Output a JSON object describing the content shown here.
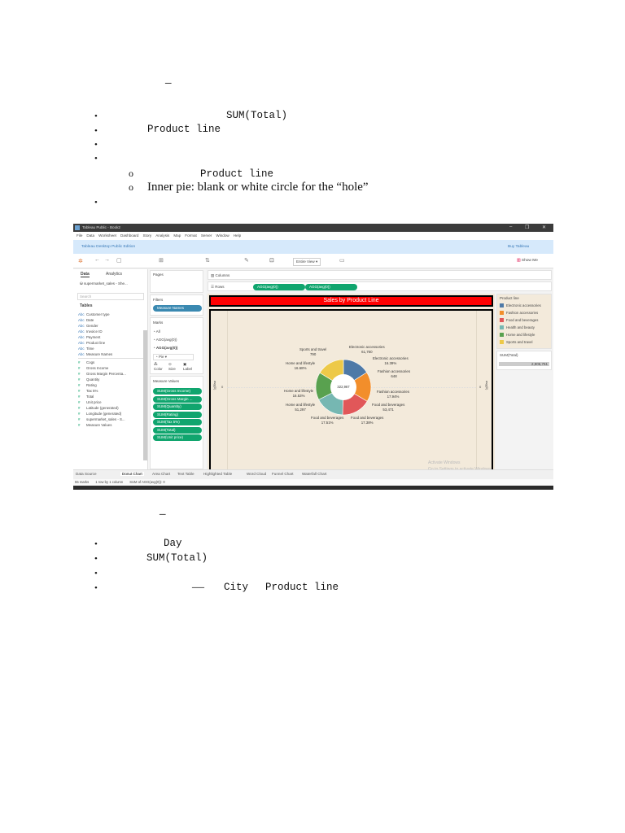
{
  "top_section": {
    "dash": "–",
    "bullets": [
      {
        "marker": "•",
        "code": "SUM(Total)"
      },
      {
        "marker": "•",
        "code": "Product line"
      },
      {
        "marker": "•"
      },
      {
        "marker": "•"
      }
    ],
    "sub_bullets": [
      {
        "marker": "o",
        "code": "Product line"
      },
      {
        "marker": "o",
        "text": "Inner pie: blank or white circle for the “hole”"
      }
    ],
    "last_bullet": "•"
  },
  "tableau": {
    "window_title": "Tableau Public - Book2",
    "window_controls": [
      "–",
      "❐",
      "✕"
    ],
    "menu": [
      "File",
      "Data",
      "Worksheet",
      "Dashboard",
      "Story",
      "Analysis",
      "Map",
      "Format",
      "Server",
      "Window",
      "Help"
    ],
    "edition": "Tableau Desktop Public Edition",
    "buy": "Buy Tableau",
    "fit_select": "Entire View",
    "show_me": "Show Me",
    "data_tabs": [
      "Data",
      "Analytics"
    ],
    "datasource": "supermarket_sales - She...",
    "search_placeholder": "Search",
    "tables_heading": "Tables",
    "dimensions": [
      "Customer type",
      "Date",
      "Gender",
      "Invoice ID",
      "Payment",
      "Product line",
      "Time",
      "Measure Names"
    ],
    "measures": [
      "Cogs",
      "Gross Income",
      "Gross Margin Percenta...",
      "Quantity",
      "Rating",
      "Tax 5%",
      "Total",
      "Unit price",
      "Latitude (generated)",
      "Longitude (generated)",
      "supermarket_sales - S...",
      "Measure Values"
    ],
    "pages": "Pages",
    "filters": "Filters",
    "filter_pill": "Measure Names",
    "marks": "Marks",
    "marks_items": [
      "All",
      "AGG(avg(0))",
      "AGG(avg(0))"
    ],
    "mark_type": "Pie",
    "mark_buttons": [
      "Color",
      "Size",
      "Label"
    ],
    "measure_values": "Measure Values",
    "measure_pills": [
      "SUM(Gross Income)",
      "SUM(Gross Margin ...",
      "SUM(Quantity)",
      "SUM(Rating)",
      "SUM(Tax 5%)",
      "SUM(Total)",
      "SUM(Unit price)"
    ],
    "columns": "Columns",
    "rows": "Rows",
    "row_pills": [
      "AGG(avg(0))",
      "AGG(avg(0))"
    ],
    "chart_title": "Sales by Product Line",
    "axis_label": "avg(0)",
    "axis_zero": "0",
    "center_total": "322,967",
    "legend_title": "Product line",
    "legend": [
      {
        "name": "Electronic accessories",
        "color": "#4e79a7"
      },
      {
        "name": "Fashion accessories",
        "color": "#f28e2b"
      },
      {
        "name": "Food and beverages",
        "color": "#e15759"
      },
      {
        "name": "Health and beauty",
        "color": "#76b7b2"
      },
      {
        "name": "Home and lifestyle",
        "color": "#59a14f"
      },
      {
        "name": "Sports and travel",
        "color": "#edc948"
      }
    ],
    "sum_total_title": "SUM(Total)",
    "sum_total_value": "2,906,761",
    "watermark": [
      "Activate Windows",
      "Go to Settings to activate Windows."
    ],
    "sheet_tabs": [
      "Data Source",
      "Donut Chart",
      "Area Chart",
      "Text Table",
      "Highlighted Table",
      "Word Cloud",
      "Funnel Chart",
      "Waterfall Chart"
    ],
    "status": [
      "55 marks",
      "1 row by 1 column",
      "SUM of AGG(avg(0)): 0"
    ]
  },
  "chart_data": {
    "type": "pie",
    "title": "Sales by Product Line",
    "center_label": "322,967",
    "slices": [
      {
        "name": "Electronic accessories",
        "percent": 16.39,
        "color": "#4e79a7"
      },
      {
        "name": "Fashion accessories",
        "percent": 17.94,
        "color": "#f28e2b"
      },
      {
        "name": "Food and beverages",
        "percent": 17.38,
        "color": "#e15759"
      },
      {
        "name": "Health and beauty",
        "percent": 17.51,
        "color": "#76b7b2"
      },
      {
        "name": "Home and lifestyle",
        "percent": 16.53,
        "color": "#59a14f"
      },
      {
        "name": "Sports and travel",
        "percent": 16.68,
        "color": "#edc948"
      }
    ],
    "labels": [
      {
        "name": "Electronic accessories",
        "value": "61,760"
      },
      {
        "name": "Electronic accessories",
        "value": "16.39%"
      },
      {
        "name": "Fashion accessories",
        "value": "648"
      },
      {
        "name": "Fashion accessories",
        "value": "17.94%"
      },
      {
        "name": "Food and beverages",
        "value": "53,471"
      },
      {
        "name": "Food and beverages",
        "value": "17.38%"
      },
      {
        "name": "Food and beverages",
        "value": "17.51%"
      },
      {
        "name": "Home and lifestyle",
        "value": "51,297"
      },
      {
        "name": "Home and lifestyle",
        "value": "16.53%"
      },
      {
        "name": "Home and lifestyle",
        "value": "16.68%"
      },
      {
        "name": "Sports and travel",
        "value": "790"
      }
    ]
  },
  "bottom_section": {
    "dash": "–",
    "bullets": [
      {
        "marker": "•",
        "code": "Day"
      },
      {
        "marker": "•",
        "code": "SUM(Total)"
      },
      {
        "marker": "•"
      },
      {
        "marker": "•",
        "dash": "—",
        "code1": "City",
        "code2": "Product line"
      }
    ]
  }
}
